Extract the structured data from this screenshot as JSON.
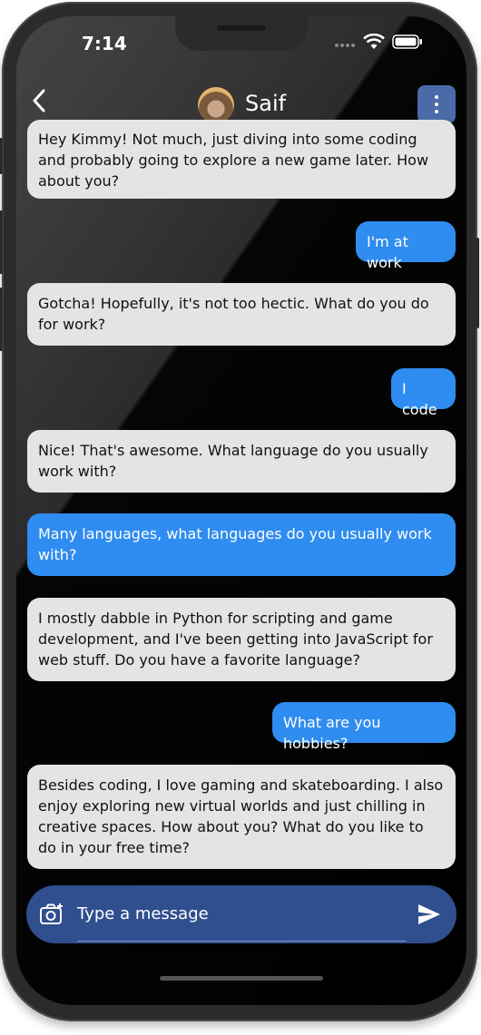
{
  "status_bar": {
    "time": "7:14"
  },
  "header": {
    "contact_name": "Saif"
  },
  "messages": [
    {
      "from": "them",
      "text": "Hey Kimmy! Not much, just diving into some coding and probably going to explore a new game later. How about you?"
    },
    {
      "from": "me",
      "text": "I'm at work"
    },
    {
      "from": "them",
      "text": "Gotcha! Hopefully, it's not too hectic. What do you do for work?"
    },
    {
      "from": "me",
      "text": "I code"
    },
    {
      "from": "them",
      "text": "Nice! That's awesome. What language do you usually work with?"
    },
    {
      "from": "me",
      "text": "Many languages, what languages do you usually work with?"
    },
    {
      "from": "them",
      "text": "I mostly dabble in Python for scripting and game development, and I've been getting into JavaScript for web stuff. Do you have a favorite language?"
    },
    {
      "from": "me",
      "text": "What are you hobbies?"
    },
    {
      "from": "them",
      "text": "Besides coding, I love gaming and skateboarding. I also enjoy exploring new virtual worlds and just chilling in creative spaces. How about you? What do you like to do in your free time?"
    }
  ],
  "composer": {
    "placeholder": "Type a message"
  },
  "colors": {
    "incoming_bubble": "#e4e4e6",
    "outgoing_bubble": "#2f8cf0",
    "input_bar": "#304f8e",
    "menu_button": "#4a6aa8"
  },
  "icons": [
    "back-icon",
    "more-vert-icon",
    "camera-icon",
    "send-icon",
    "wifi-icon",
    "battery-icon",
    "signal-icon"
  ]
}
